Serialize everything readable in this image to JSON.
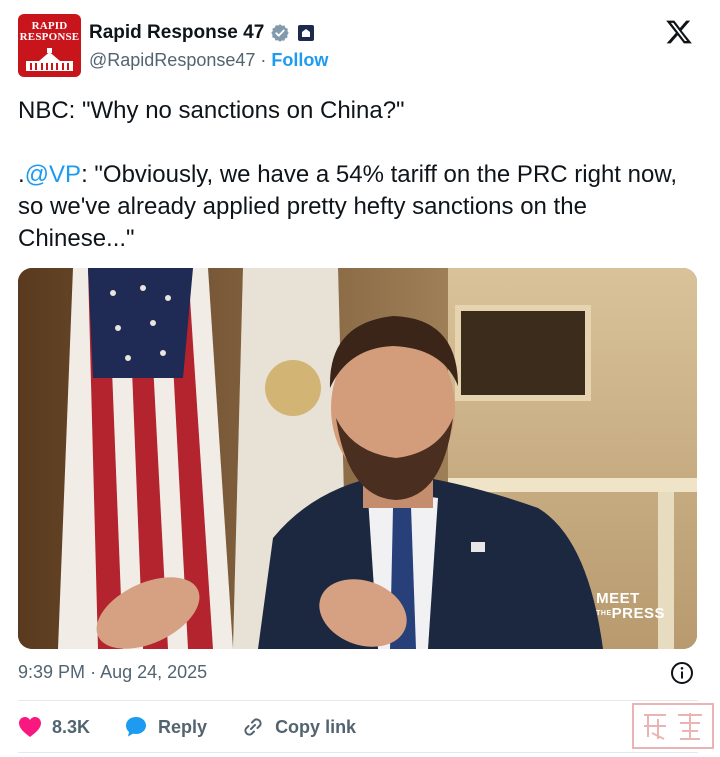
{
  "account": {
    "name": "Rapid Response 47",
    "handle": "@RapidResponse47",
    "separator": "·",
    "follow_label": "Follow",
    "avatar_text_line1": "RAPID",
    "avatar_text_line2": "RESPONSE"
  },
  "tweet": {
    "line1": "NBC: \"Why no sanctions on China?\"",
    "line2_prefix": ".",
    "line2_mention": "@VP",
    "line2_rest": ": \"Obviously, we have a 54% tariff on the PRC right now, so we've already applied pretty hefty sanctions on the Chinese...\""
  },
  "media": {
    "watermark_line1": "MEET",
    "watermark_the": "THE",
    "watermark_line2": "PRESS"
  },
  "meta": {
    "time": "9:39 PM",
    "separator": "·",
    "date": "Aug 24, 2025"
  },
  "actions": {
    "like_count": "8.3K",
    "reply_label": "Reply",
    "copy_label": "Copy link"
  },
  "colors": {
    "accent": "#1d9bf0",
    "like": "#f91880",
    "text": "#0f1419",
    "secondary": "#536471",
    "brand_red": "#c8151b"
  },
  "icons": {
    "verified": "verified-badge-icon",
    "government": "government-badge-icon",
    "x_logo": "x-logo-icon",
    "info": "info-icon",
    "like": "heart-icon",
    "reply": "speech-bubble-icon",
    "copy": "link-icon"
  }
}
